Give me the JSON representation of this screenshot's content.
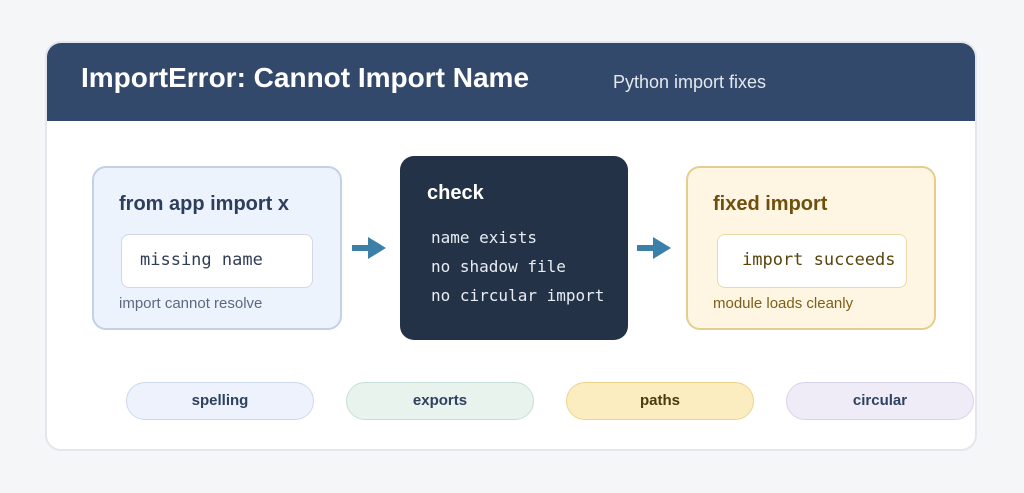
{
  "header": {
    "title": "ImportError: Cannot Import Name",
    "subtitle": "Python import fixes"
  },
  "colors": {
    "header_bg": "#33496b",
    "arrow": "#3a80a8",
    "check_bg": "#233247"
  },
  "problem": {
    "heading": "from app import x",
    "code": "missing name",
    "note": "import cannot resolve"
  },
  "check": {
    "heading": "check",
    "items": [
      "name exists",
      "no shadow file",
      "no circular import"
    ]
  },
  "fix": {
    "heading": "fixed import",
    "code": "import succeeds",
    "note": "module loads cleanly"
  },
  "tags": [
    "spelling",
    "exports",
    "paths",
    "circular"
  ],
  "icons": {
    "arrow_1": "arrow-right-icon",
    "arrow_2": "arrow-right-icon"
  }
}
